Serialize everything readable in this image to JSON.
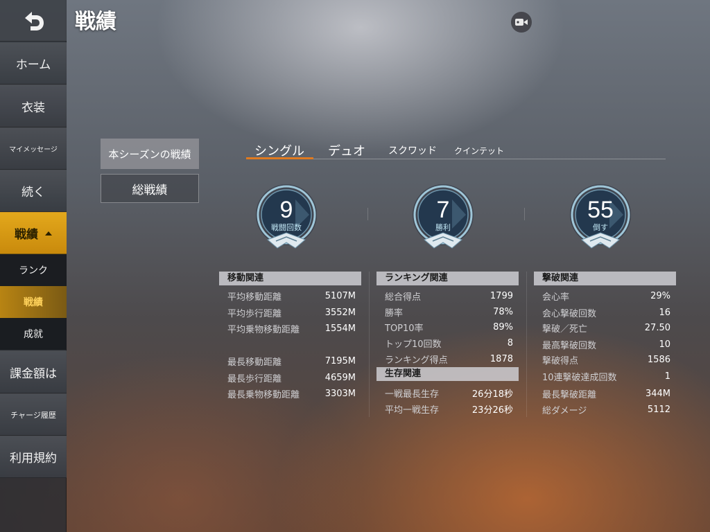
{
  "header": {
    "title": "戦績"
  },
  "sidebar": {
    "items": [
      {
        "label": "ホーム"
      },
      {
        "label": "衣装"
      },
      {
        "label": "マイメッセージ"
      },
      {
        "label": "続く"
      },
      {
        "label": "戦績"
      },
      {
        "label": "課金額は"
      },
      {
        "label": "チャージ履歴"
      },
      {
        "label": "利用規約"
      }
    ],
    "subitems": [
      {
        "label": "ランク"
      },
      {
        "label": "戦績"
      },
      {
        "label": "成就"
      }
    ]
  },
  "season": {
    "current": "本シーズンの戦績",
    "total": "総戦績"
  },
  "tabs": [
    "シングル",
    "デュオ",
    "スクワッド",
    "クインテット"
  ],
  "badges": [
    {
      "value": "9",
      "label": "戦闘回数"
    },
    {
      "value": "7",
      "label": "勝利"
    },
    {
      "value": "55",
      "label": "倒す"
    }
  ],
  "panels": {
    "movement": {
      "title": "移動関連",
      "rows": [
        {
          "k": "平均移動距離",
          "v": "5107M"
        },
        {
          "k": "平均歩行距離",
          "v": "3552M"
        },
        {
          "k": "平均乗物移動距離",
          "v": "1554M"
        },
        {
          "k": "最長移動距離",
          "v": "7195M"
        },
        {
          "k": "最長歩行距離",
          "v": "4659M"
        },
        {
          "k": "最長乗物移動距離",
          "v": "3303M"
        }
      ]
    },
    "ranking": {
      "title": "ランキング関連",
      "rows": [
        {
          "k": "総合得点",
          "v": "1799"
        },
        {
          "k": "勝率",
          "v": "78%"
        },
        {
          "k": "TOP10率",
          "v": "89%"
        },
        {
          "k": "トップ10回数",
          "v": "8"
        },
        {
          "k": "ランキング得点",
          "v": "1878"
        }
      ]
    },
    "survival": {
      "title": "生存関連",
      "rows": [
        {
          "k": "一戦最長生存",
          "v": "26分18秒"
        },
        {
          "k": "平均一戦生存",
          "v": "23分26秒"
        }
      ]
    },
    "kills": {
      "title": "撃破関連",
      "rows": [
        {
          "k": "会心率",
          "v": "29%"
        },
        {
          "k": "会心撃破回数",
          "v": "16"
        },
        {
          "k": "撃破／死亡",
          "v": "27.50"
        },
        {
          "k": "最高撃破回数",
          "v": "10"
        },
        {
          "k": "撃破得点",
          "v": "1586"
        },
        {
          "k": "10連撃破達成回数",
          "v": "1"
        },
        {
          "k": "最長撃破距離",
          "v": "344M"
        },
        {
          "k": "総ダメージ",
          "v": "5112"
        }
      ]
    }
  },
  "colors": {
    "accent": "#e3a81c",
    "tab_underline": "#e07a20",
    "badge_ring": "#9fc6d8"
  }
}
